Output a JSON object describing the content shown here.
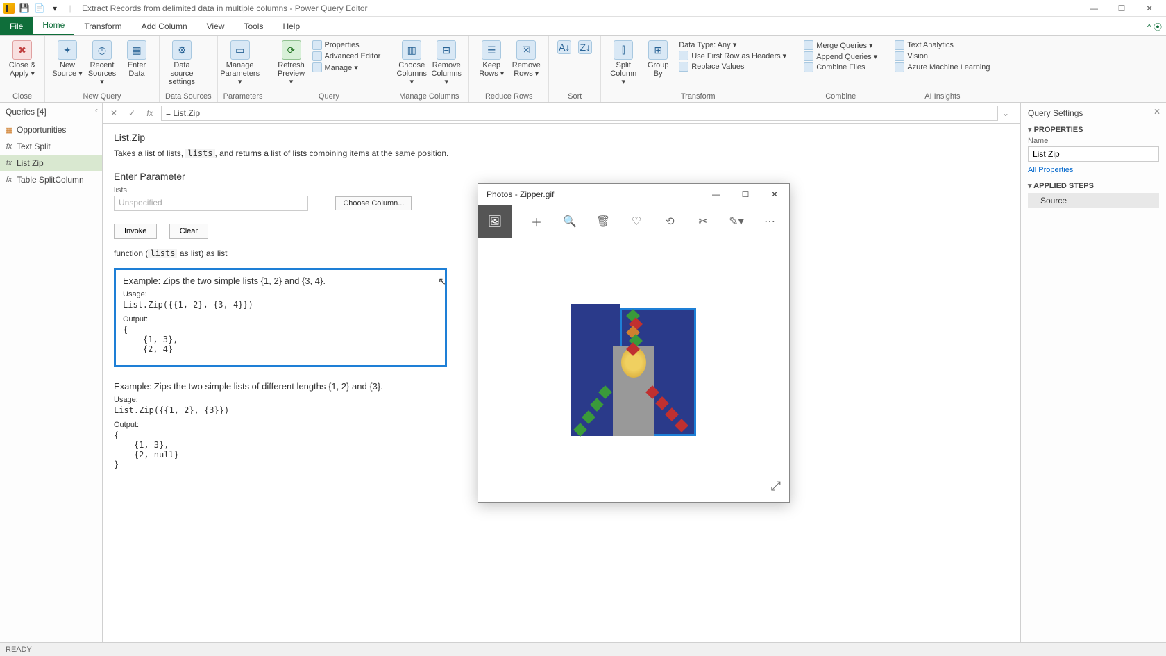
{
  "titlebar": {
    "title": "Extract Records from delimited data in multiple columns - Power Query Editor"
  },
  "menu": {
    "file": "File",
    "home": "Home",
    "transform": "Transform",
    "addColumn": "Add Column",
    "view": "View",
    "tools": "Tools",
    "help": "Help"
  },
  "ribbon": {
    "close": {
      "closeApply": "Close &\nApply ▾",
      "group": "Close"
    },
    "newQuery": {
      "newSource": "New\nSource ▾",
      "recentSources": "Recent\nSources ▾",
      "enterData": "Enter\nData",
      "group": "New Query"
    },
    "dataSources": {
      "settings": "Data source\nsettings",
      "group": "Data Sources"
    },
    "parameters": {
      "manage": "Manage\nParameters ▾",
      "group": "Parameters"
    },
    "query": {
      "refresh": "Refresh\nPreview ▾",
      "properties": "Properties",
      "advanced": "Advanced Editor",
      "manage": "Manage ▾",
      "group": "Query"
    },
    "manageCols": {
      "choose": "Choose\nColumns ▾",
      "remove": "Remove\nColumns ▾",
      "group": "Manage Columns"
    },
    "reduceRows": {
      "keep": "Keep\nRows ▾",
      "remove": "Remove\nRows ▾",
      "group": "Reduce Rows"
    },
    "sort": {
      "group": "Sort"
    },
    "transform": {
      "split": "Split\nColumn ▾",
      "groupBy": "Group\nBy",
      "dataType": "Data Type: Any ▾",
      "firstRow": "Use First Row as Headers ▾",
      "replace": "Replace Values",
      "group": "Transform"
    },
    "combine": {
      "merge": "Merge Queries ▾",
      "append": "Append Queries ▾",
      "combineFiles": "Combine Files",
      "group": "Combine"
    },
    "ai": {
      "textAnalytics": "Text Analytics",
      "vision": "Vision",
      "aml": "Azure Machine Learning",
      "group": "AI Insights"
    }
  },
  "queriesPanel": {
    "header": "Queries [4]",
    "items": [
      {
        "icon": "▦",
        "label": "Opportunities"
      },
      {
        "icon": "fx",
        "label": "Text Split"
      },
      {
        "icon": "fx",
        "label": "List Zip",
        "selected": true
      },
      {
        "icon": "fx",
        "label": "Table SplitColumn"
      }
    ]
  },
  "formulaBar": {
    "value": "= List.Zip"
  },
  "doc": {
    "title": "List.Zip",
    "desc_pre": "Takes a list of lists, ",
    "desc_code": "lists",
    "desc_post": ", and returns a list of lists combining items at the same position.",
    "enterParam": "Enter Parameter",
    "paramName": "lists",
    "paramPlaceholder": "Unspecified",
    "chooseCol": "Choose Column...",
    "invoke": "Invoke",
    "clear": "Clear",
    "sig_pre": "function (",
    "sig_code": "lists",
    "sig_post": " as list) as list",
    "ex1": {
      "title": "Example: Zips the two simple lists {1, 2} and {3, 4}.",
      "usage": "Usage:",
      "code": "List.Zip({{1, 2}, {3, 4}})",
      "outLbl": "Output:",
      "out": "{\n    {1, 3},\n    {2, 4}"
    },
    "ex2": {
      "title": "Example: Zips the two simple lists of different lengths {1, 2} and {3}.",
      "usage": "Usage:",
      "code": "List.Zip({{1, 2}, {3}})",
      "outLbl": "Output:",
      "out": "{\n    {1, 3},\n    {2, null}\n}"
    }
  },
  "settings": {
    "title": "Query Settings",
    "properties": "PROPERTIES",
    "nameLbl": "Name",
    "nameVal": "List Zip",
    "allProps": "All Properties",
    "appliedSteps": "APPLIED STEPS",
    "step": "Source"
  },
  "status": {
    "ready": "READY"
  },
  "photos": {
    "title": "Photos - Zipper.gif"
  }
}
